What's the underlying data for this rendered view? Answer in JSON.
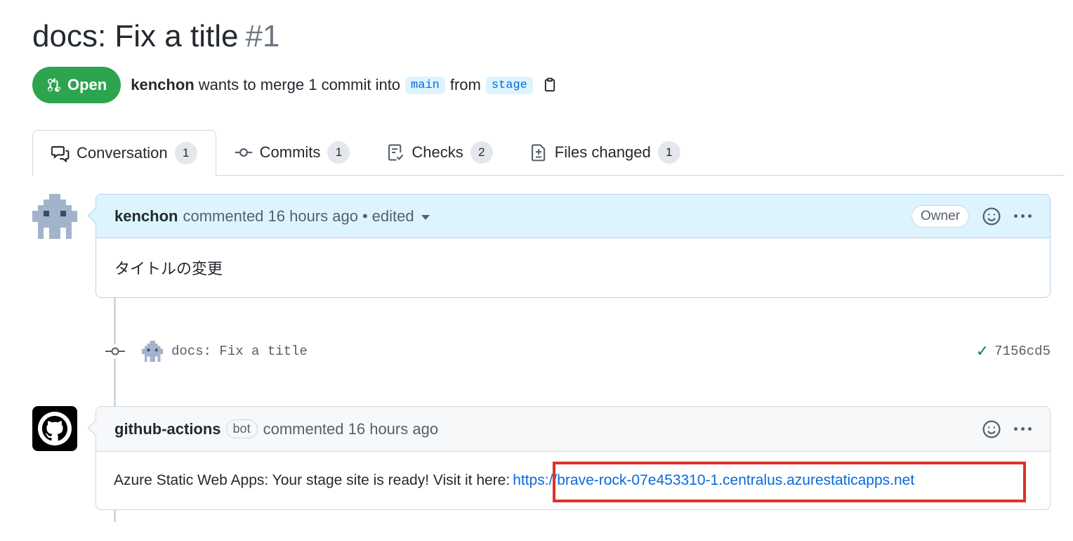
{
  "pr": {
    "title": "docs: Fix a title",
    "number": "#1",
    "state": "Open",
    "author": "kenchon",
    "merge_text": "wants to merge 1 commit into",
    "base_branch": "main",
    "from_text": "from",
    "head_branch": "stage"
  },
  "tabs": [
    {
      "label": "Conversation",
      "count": "1",
      "icon": "comment-discussion-icon"
    },
    {
      "label": "Commits",
      "count": "1",
      "icon": "git-commit-icon"
    },
    {
      "label": "Checks",
      "count": "2",
      "icon": "checklist-icon"
    },
    {
      "label": "Files changed",
      "count": "1",
      "icon": "file-diff-icon"
    }
  ],
  "comment1": {
    "author": "kenchon",
    "meta": "commented 16 hours ago",
    "dot": "•",
    "edited": "edited",
    "role": "Owner",
    "body": "タイトルの変更"
  },
  "commit": {
    "message": "docs: Fix a title",
    "check": "✓",
    "sha": "7156cd5"
  },
  "comment2": {
    "author": "github-actions",
    "bot_label": "bot",
    "meta": "commented 16 hours ago",
    "body_prefix": "Azure Static Web Apps: Your stage site is ready! Visit it here:",
    "link": "https://brave-rock-07e453310-1.centralus.azurestaticapps.net"
  },
  "colors": {
    "open_green": "#2da44e",
    "link_blue": "#0969da",
    "highlight_red": "#e0312b"
  }
}
